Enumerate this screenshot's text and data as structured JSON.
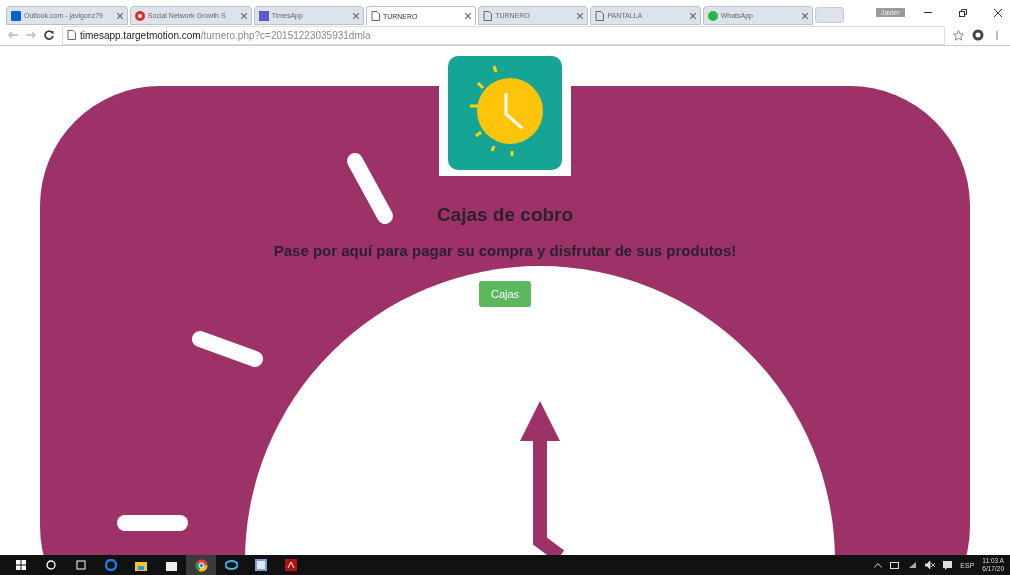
{
  "browser": {
    "tabs": [
      {
        "title": "Outlook.com - javigonz79",
        "kind": "outlook",
        "selected": false
      },
      {
        "title": "Social Network Growth S",
        "kind": "growth",
        "selected": false
      },
      {
        "title": "TimesApp",
        "kind": "times",
        "selected": false
      },
      {
        "title": "TURNERO",
        "kind": "page",
        "selected": true
      },
      {
        "title": "TURNERO",
        "kind": "page",
        "selected": false
      },
      {
        "title": "PANTALLA",
        "kind": "page",
        "selected": false
      },
      {
        "title": "WhatsApp",
        "kind": "whatsapp",
        "selected": false
      }
    ],
    "profile": "Javier",
    "address": {
      "host": "timesapp.targetmotion.com",
      "path": "/turnero.php?c=20151223035931dmla"
    }
  },
  "page": {
    "heading": "Cajas de cobro",
    "message": "Pase por aquí para pagar su compra y disfrutar de sus produtos!",
    "button": "Cajas"
  },
  "taskbar": {
    "apps": [
      {
        "kind": "edge"
      },
      {
        "kind": "files"
      },
      {
        "kind": "store"
      },
      {
        "kind": "chrome",
        "selected": true
      },
      {
        "kind": "ie"
      },
      {
        "kind": "word"
      },
      {
        "kind": "pdf"
      }
    ],
    "language": "ESP",
    "time": "11:03 A",
    "date": "6/17/20"
  }
}
